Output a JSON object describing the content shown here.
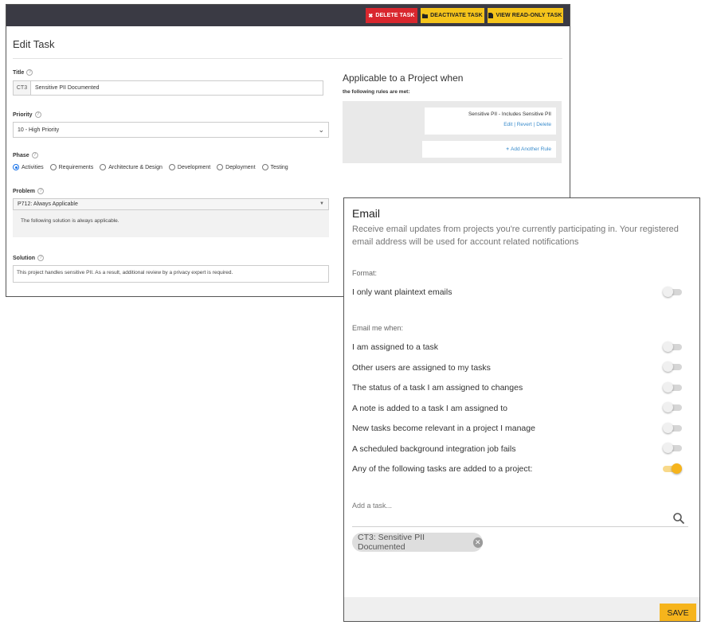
{
  "edit_task": {
    "toolbar": {
      "delete_label": "DELETE TASK",
      "deactivate_label": "DEACTIVATE TASK",
      "readonly_label": "VIEW READ-ONLY TASK"
    },
    "page_title": "Edit Task",
    "help_glyph": "?",
    "title_field": {
      "label": "Title",
      "prefix": "CT3",
      "value": "Sensitive PII Documented"
    },
    "priority_field": {
      "label": "Priority",
      "value": "10 - High Priority"
    },
    "phase_field": {
      "label": "Phase",
      "options": [
        "Activities",
        "Requirements",
        "Architecture & Design",
        "Development",
        "Deployment",
        "Testing"
      ],
      "selected_index": 0
    },
    "problem_field": {
      "label": "Problem",
      "value": "P712: Always Applicable",
      "description": "The following solution is always applicable."
    },
    "solution_field": {
      "label": "Solution",
      "value": "This project handles sensitive PII. As a result, additional review by a privacy expert is required."
    },
    "applicable": {
      "title": "Applicable to a Project when",
      "subtitle": "the following rules are met:",
      "rule_text": "Sensitive PII - Includes Sensitive PII",
      "rule_edit": "Edit",
      "rule_separator": "|",
      "rule_revert": "Revert",
      "rule_delete": "Delete",
      "add_rule": "Add Another Rule"
    }
  },
  "email_settings": {
    "title": "Email",
    "description": "Receive email updates from projects you're currently participating in. Your registered email address will be used for account related notifications",
    "format_label": "Format:",
    "format_options": [
      {
        "label": "I only want plaintext emails",
        "enabled": false
      }
    ],
    "when_label": "Email me when:",
    "when_options": [
      {
        "label": "I am assigned to a task",
        "enabled": false
      },
      {
        "label": "Other users are assigned to my tasks",
        "enabled": false
      },
      {
        "label": "The status of a task I am assigned to changes",
        "enabled": false
      },
      {
        "label": "A note is added to a task I am assigned to",
        "enabled": false
      },
      {
        "label": "New tasks become relevant in a project I manage",
        "enabled": false
      },
      {
        "label": "A scheduled background integration job fails",
        "enabled": false
      },
      {
        "label": "Any of the following tasks are added to a project:",
        "enabled": true
      }
    ],
    "add_task_placeholder": "Add a task...",
    "selected_task": "CT3: Sensitive PII Documented",
    "save_label": "SAVE",
    "colors": {
      "accent": "#f6b41c",
      "danger": "#d9272e",
      "link": "#3a8ccc",
      "topbar": "#3a3a44"
    }
  }
}
